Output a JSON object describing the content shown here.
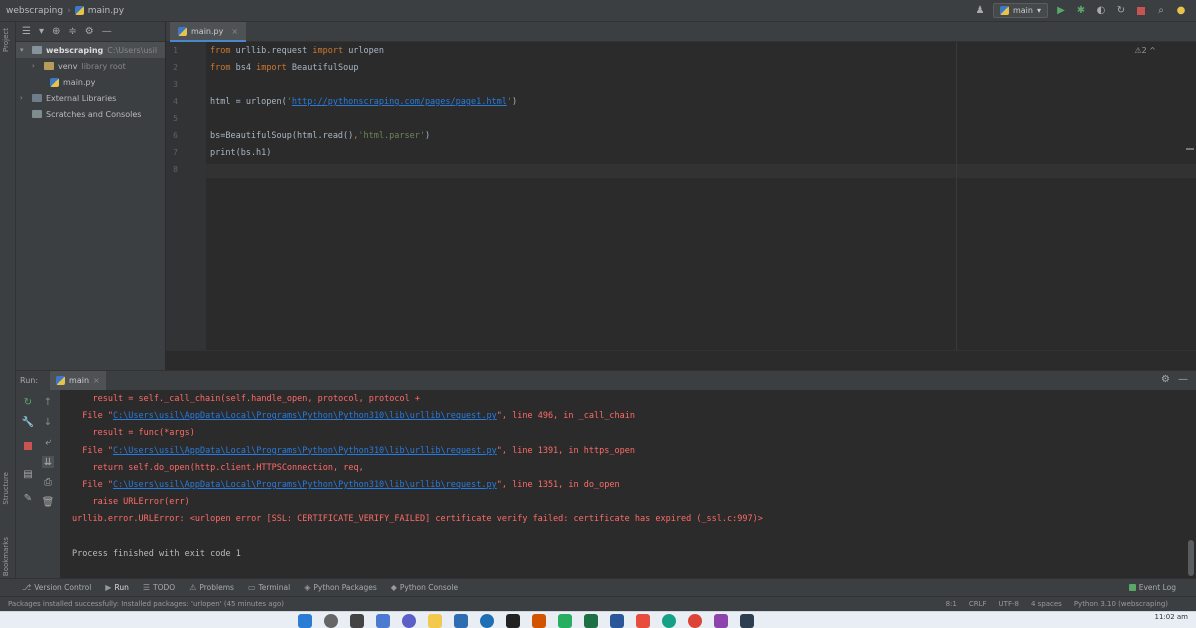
{
  "titlebar": {
    "project": "webscraping",
    "file": "main.py",
    "run_config": "main"
  },
  "left_strip": {
    "project_tab": "Project",
    "structure_tab": "Structure",
    "bookmarks_tab": "Bookmarks"
  },
  "project_tree": {
    "root": "webscraping",
    "root_path": "C:\\Users\\usil",
    "venv": "venv",
    "venv_note": "library root",
    "main_file": "main.py",
    "external": "External Libraries",
    "scratches": "Scratches and Consoles"
  },
  "editor": {
    "tab_label": "main.py",
    "inspection": "⚠2 ^",
    "lines": [
      {
        "num": "1",
        "parts": [
          [
            "kw",
            "from "
          ],
          [
            "plain",
            "urllib.request "
          ],
          [
            "kw",
            "import "
          ],
          [
            "plain",
            "urlopen"
          ]
        ]
      },
      {
        "num": "2",
        "parts": [
          [
            "kw",
            "from "
          ],
          [
            "plain",
            "bs4 "
          ],
          [
            "kw",
            "import "
          ],
          [
            "plain",
            "BeautifulSoup"
          ]
        ]
      },
      {
        "num": "3",
        "parts": []
      },
      {
        "num": "4",
        "parts": [
          [
            "plain",
            "html = urlopen("
          ],
          [
            "str",
            "'"
          ],
          [
            "url",
            "http://pythonscraping.com/pages/page1.html"
          ],
          [
            "str",
            "'"
          ],
          [
            "plain",
            ")"
          ]
        ]
      },
      {
        "num": "5",
        "parts": []
      },
      {
        "num": "6",
        "parts": [
          [
            "plain",
            "bs=BeautifulSoup(html.read()"
          ],
          [
            "kw",
            ","
          ],
          [
            "str",
            "'html.parser'"
          ],
          [
            "plain",
            ")"
          ]
        ]
      },
      {
        "num": "7",
        "parts": [
          [
            "plain",
            "print(bs.h1)"
          ]
        ]
      },
      {
        "num": "8",
        "parts": []
      }
    ]
  },
  "run_panel": {
    "title": "Run:",
    "tab": "main",
    "console": [
      {
        "type": "err",
        "text": "    result = self._call_chain(self.handle_open, protocol, protocol +"
      },
      {
        "type": "file",
        "pre": "  File \"",
        "link": "C:\\Users\\usil\\AppData\\Local\\Programs\\Python\\Python310\\lib\\urllib\\request.py",
        "post": "\", line 496, in _call_chain"
      },
      {
        "type": "err",
        "text": "    result = func(*args)"
      },
      {
        "type": "file",
        "pre": "  File \"",
        "link": "C:\\Users\\usil\\AppData\\Local\\Programs\\Python\\Python310\\lib\\urllib\\request.py",
        "post": "\", line 1391, in https_open"
      },
      {
        "type": "err",
        "text": "    return self.do_open(http.client.HTTPSConnection, req,"
      },
      {
        "type": "file",
        "pre": "  File \"",
        "link": "C:\\Users\\usil\\AppData\\Local\\Programs\\Python\\Python310\\lib\\urllib\\request.py",
        "post": "\", line 1351, in do_open"
      },
      {
        "type": "err",
        "text": "    raise URLError(err)"
      },
      {
        "type": "err",
        "text": "urllib.error.URLError: <urlopen error [SSL: CERTIFICATE_VERIFY_FAILED] certificate verify failed: certificate has expired (_ssl.c:997)>"
      },
      {
        "type": "blank",
        "text": ""
      },
      {
        "type": "normal",
        "text": "Process finished with exit code 1"
      }
    ]
  },
  "tool_tabs": [
    {
      "icon": "⎇",
      "label": "Version Control"
    },
    {
      "icon": "▶",
      "label": "Run"
    },
    {
      "icon": "☰",
      "label": "TODO"
    },
    {
      "icon": "⚠",
      "label": "Problems"
    },
    {
      "icon": "▭",
      "label": "Terminal"
    },
    {
      "icon": "◈",
      "label": "Python Packages"
    },
    {
      "icon": "◆",
      "label": "Python Console"
    }
  ],
  "event_log": "Event Log",
  "status": {
    "message": "Packages installed successfully: Installed packages: 'urlopen' (45 minutes ago)",
    "position": "8:1",
    "line_sep": "CRLF",
    "encoding": "UTF-8",
    "indent": "4 spaces",
    "interpreter": "Python 3.10 (webscraping)"
  },
  "taskbar": {
    "time": "11:02 am"
  },
  "colors": {
    "accent": "#4a88c7",
    "error": "#ff6b68",
    "keyword": "#cc7832",
    "string": "#6a8759",
    "link": "#287bde"
  }
}
